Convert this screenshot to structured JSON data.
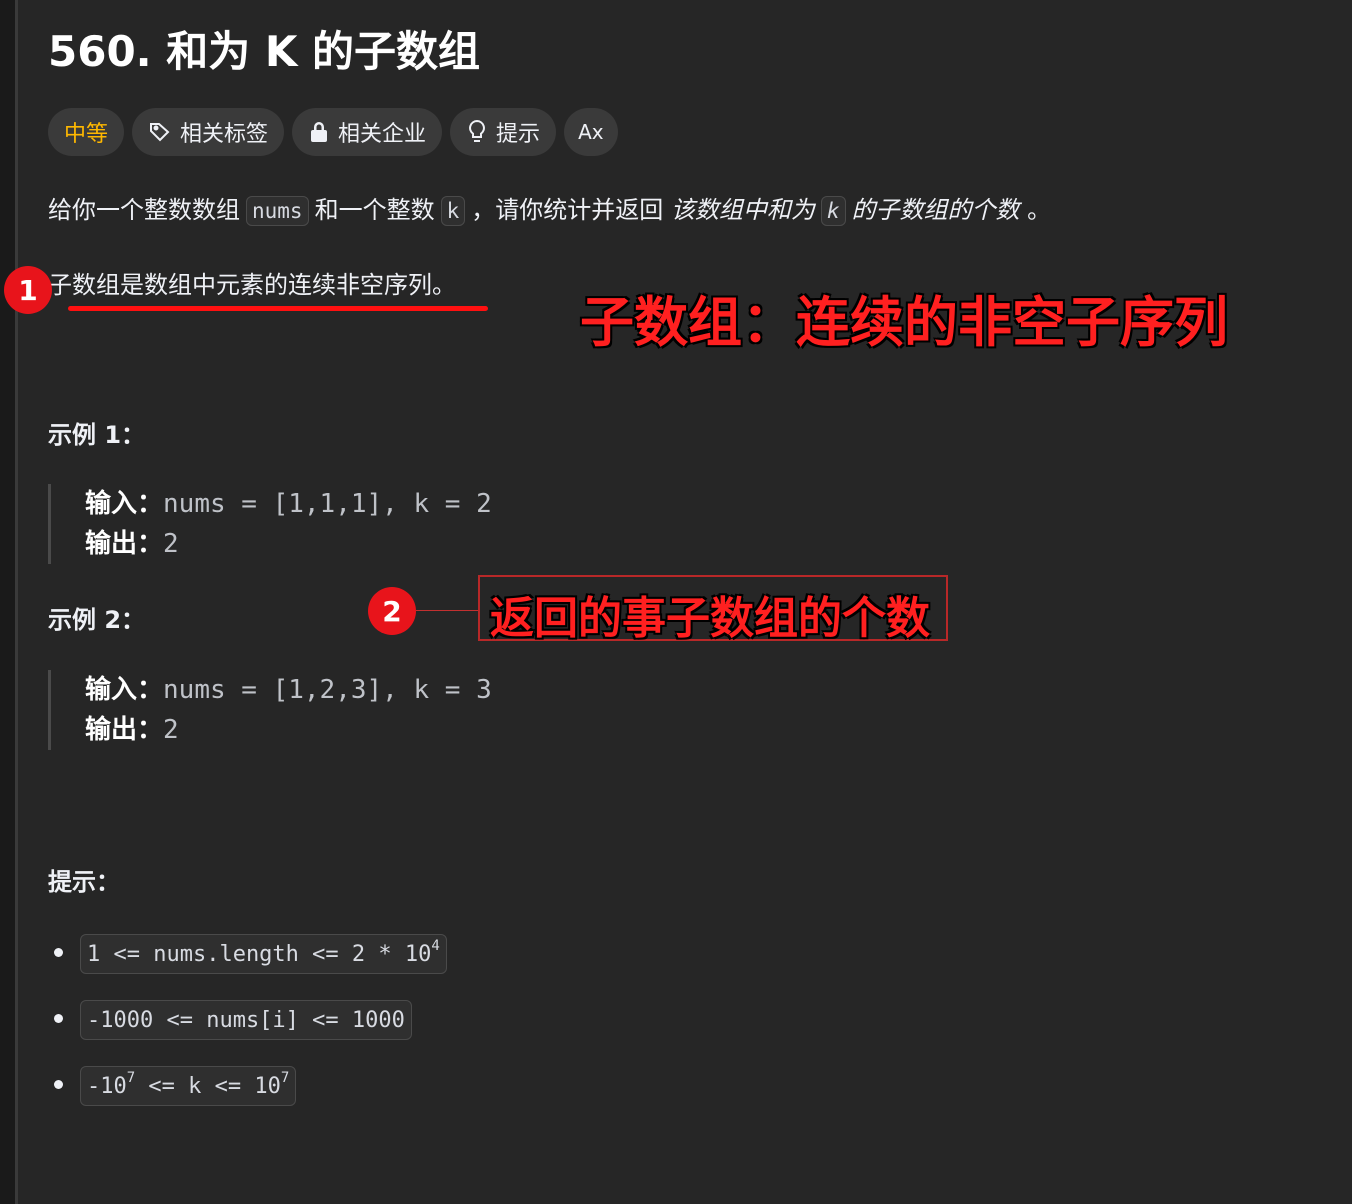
{
  "problem": {
    "title": "560. 和为 K 的子数组",
    "tags": {
      "difficulty": "中等",
      "related_tags": "相关标签",
      "related_companies": "相关企业",
      "hint": "提示",
      "translate": "Ax"
    },
    "description": {
      "part1": "给你一个整数数组",
      "code1": "nums",
      "part2": "和一个整数",
      "code2": "k",
      "part3": "，请你统计并返回",
      "em1": "该数组中和为",
      "code3": "k",
      "em2": "的子数组的个数",
      "part4": "。"
    },
    "subarray_definition": "子数组是数组中元素的连续非空序列。",
    "examples": [
      {
        "title": "示例 1：",
        "input_label": "输入：",
        "input_value": "nums = [1,1,1], k = 2",
        "output_label": "输出：",
        "output_value": "2"
      },
      {
        "title": "示例 2：",
        "input_label": "输入：",
        "input_value": "nums = [1,2,3], k = 3",
        "output_label": "输出：",
        "output_value": "2"
      }
    ],
    "constraints_title": "提示：",
    "constraints": [
      {
        "pre": "1 <= nums.length <= 2 * 10",
        "sup": "4",
        "post": ""
      },
      {
        "pre": "-1000 <= nums[i] <= 1000",
        "sup": "",
        "post": ""
      },
      {
        "pre": "-10",
        "sup": "7",
        "mid": " <= k <= 10",
        "sup2": "7"
      }
    ]
  },
  "annotations": {
    "badge1": "1",
    "note1": "子数组：连续的非空子序列",
    "badge2": "2",
    "note2": "返回的事子数组的个数"
  },
  "colors": {
    "background": "#262626",
    "difficulty_medium": "#ffb800",
    "annotation_red": "#ff2020"
  },
  "icons": {
    "related_tags": "tag-icon",
    "related_companies": "lock-icon",
    "hint": "lightbulb-icon",
    "translate": "translate-icon"
  }
}
